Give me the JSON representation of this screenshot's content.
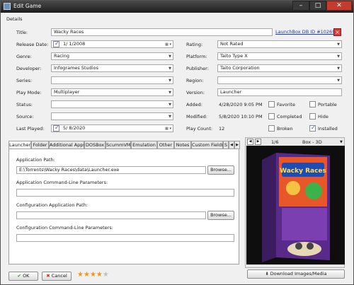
{
  "window": {
    "title": "Edit Game",
    "minimize": "–",
    "maximize": "□",
    "close": "✕"
  },
  "section": "Details",
  "left_fields": {
    "title": {
      "label": "Title:",
      "value": "Wacky Races"
    },
    "release_date": {
      "label": "Release Date:",
      "value": "1/  1/2008",
      "checked": true
    },
    "genre": {
      "label": "Genre:",
      "value": "Racing"
    },
    "developer": {
      "label": "Developer:",
      "value": "Infogrames Studios"
    },
    "series": {
      "label": "Series:",
      "value": ""
    },
    "play_mode": {
      "label": "Play Mode:",
      "value": "Multiplayer"
    },
    "status": {
      "label": "Status:",
      "value": ""
    },
    "source": {
      "label": "Source:",
      "value": ""
    },
    "last_played": {
      "label": "Last Played:",
      "value": "5/  8/2020",
      "checked": true
    }
  },
  "launchbox_link": "LaunchBox DB ID #102695",
  "right_fields": {
    "rating": {
      "label": "Rating:",
      "value": "Not Rated"
    },
    "platform": {
      "label": "Platform:",
      "value": "Taito Type X"
    },
    "publisher": {
      "label": "Publisher:",
      "value": "Taito Corporation"
    },
    "region": {
      "label": "Region:",
      "value": ""
    },
    "version": {
      "label": "Version:",
      "value": "Launcher"
    },
    "added": {
      "label": "Added:",
      "value": "4/28/2020 9:05 PM"
    },
    "modified": {
      "label": "Modified:",
      "value": "5/8/2020 10:10 PM"
    },
    "play_count": {
      "label": "Play Count:",
      "value": "12"
    }
  },
  "flags": {
    "favorite": {
      "label": "Favorite",
      "checked": false
    },
    "portable": {
      "label": "Portable",
      "checked": false
    },
    "completed": {
      "label": "Completed",
      "checked": false
    },
    "hide": {
      "label": "Hide",
      "checked": false
    },
    "broken": {
      "label": "Broken",
      "checked": false
    },
    "installed": {
      "label": "Installed",
      "checked": true
    }
  },
  "tabs": [
    "Launcher",
    "Folder",
    "Additional Apps",
    "DOSBox",
    "ScummVM",
    "Emulation",
    "Other",
    "Notes",
    "Custom Fields",
    "S"
  ],
  "launcher": {
    "app_path_label": "Application Path:",
    "app_path_value": "E:\\Torrents\\Wacky Races\\data\\Launcher.exe",
    "browse": "Browse...",
    "app_params_label": "Application Command-Line Parameters:",
    "config_path_label": "Configuration Application Path:",
    "config_params_label": "Configuration Command-Line Parameters:"
  },
  "media": {
    "counter": "1/6",
    "type": "Box - 3D",
    "art_title": "Wacky Races",
    "download_label": "Download Images/Media"
  },
  "footer": {
    "ok": "OK",
    "cancel": "Cancel",
    "stars": 4,
    "stars_max": 5
  }
}
